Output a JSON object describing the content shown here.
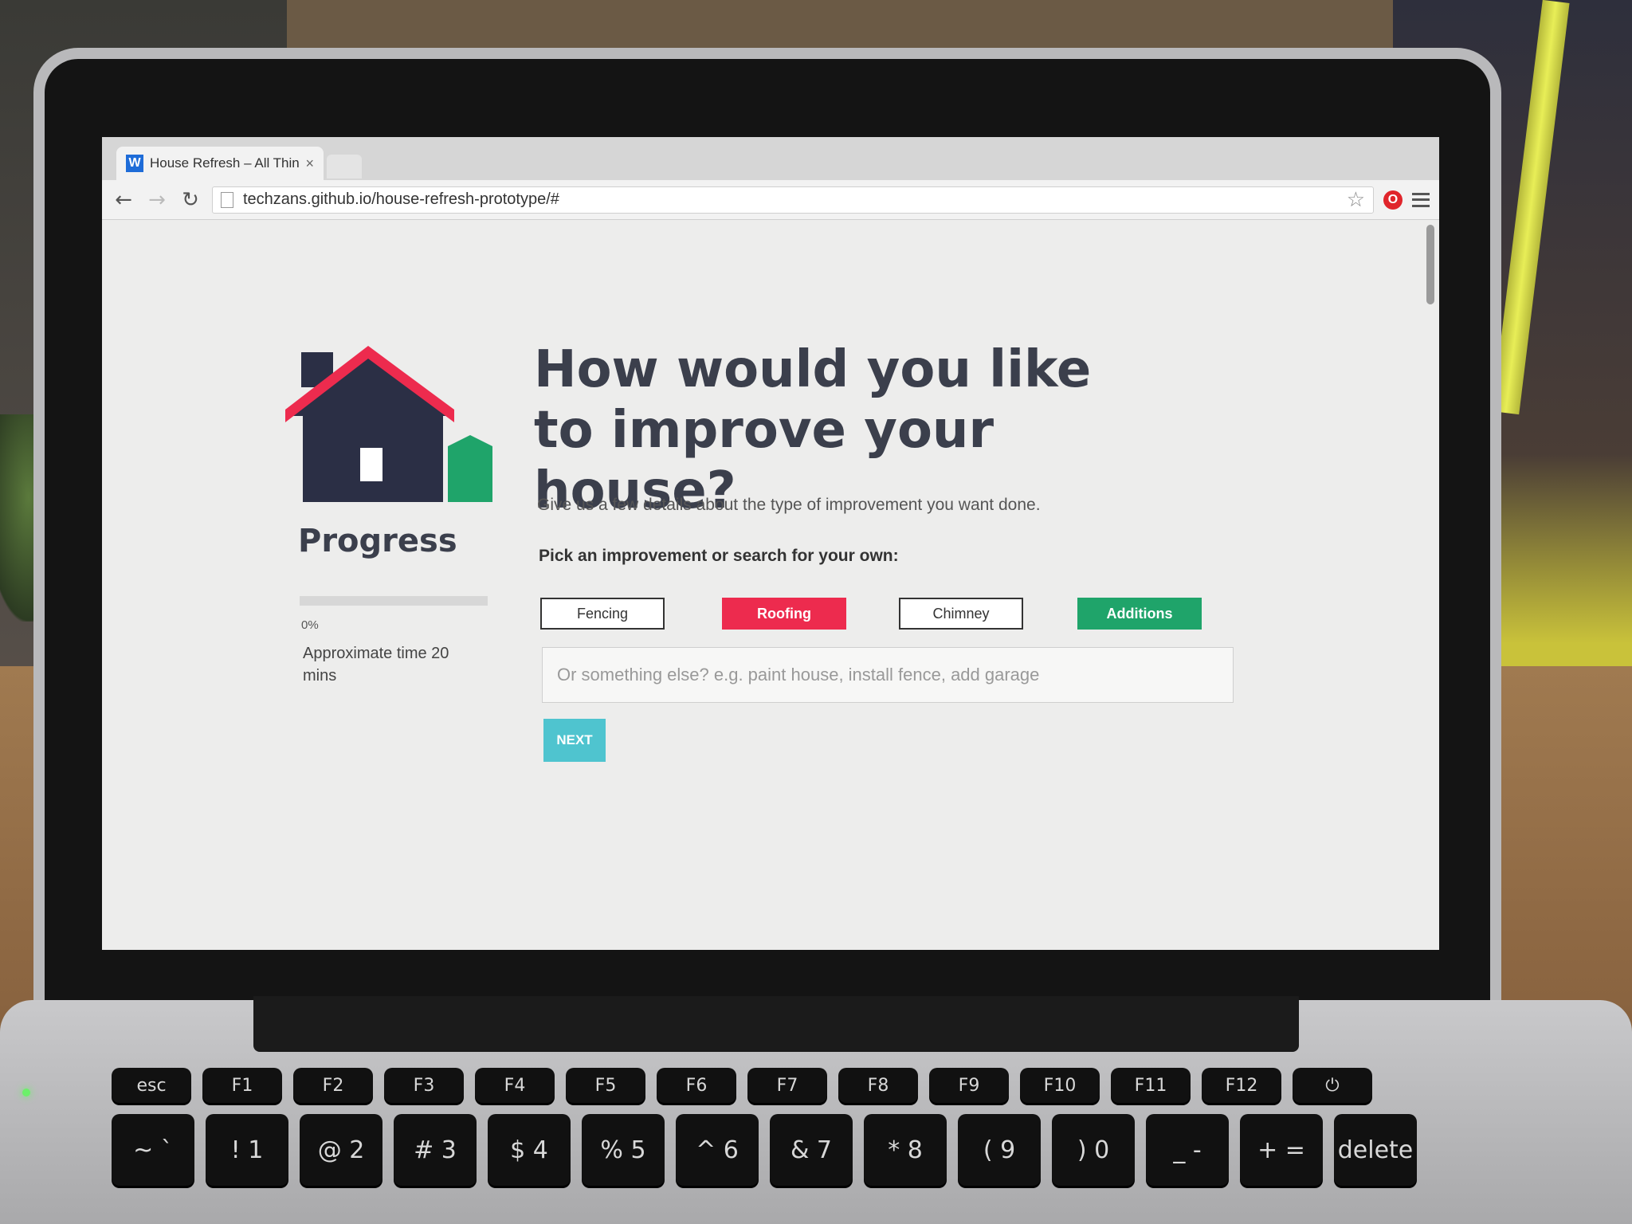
{
  "browser": {
    "tab_title": "House Refresh – All Thing",
    "favicon_letter": "W",
    "tab_close": "×",
    "url": "techzans.github.io/house-refresh-prototype/#",
    "extension_letter": "O"
  },
  "sidebar": {
    "progress_title": "Progress",
    "progress_percent": "0%",
    "progress_value": 0,
    "approx_time": "Approximate time 20 mins"
  },
  "main": {
    "headline": "How would you like to improve your house?",
    "subtext": "Give us a few details about the type of improvement you want done.",
    "pick_label": "Pick an improvement or search for your own:",
    "options": [
      {
        "label": "Fencing",
        "style": "outline"
      },
      {
        "label": "Roofing",
        "style": "red"
      },
      {
        "label": "Chimney",
        "style": "outline"
      },
      {
        "label": "Additions",
        "style": "green"
      }
    ],
    "search_placeholder": "Or something else? e.g. paint house, install fence, add garage",
    "next_label": "NEXT"
  },
  "keyboard": {
    "fn_row": [
      "esc",
      "F1",
      "F2",
      "F3",
      "F4",
      "F5",
      "F6",
      "F7",
      "F8",
      "F9",
      "F10",
      "F11",
      "F12",
      "⏻"
    ],
    "num_row": [
      "~ `",
      "! 1",
      "@ 2",
      "# 3",
      "$ 4",
      "% 5",
      "^ 6",
      "& 7",
      "* 8",
      "( 9",
      ") 0",
      "_ -",
      "+ =",
      "delete"
    ]
  },
  "colors": {
    "roof_red": "#ed2b4e",
    "house_navy": "#2b2f45",
    "accent_green": "#1fa46a",
    "next_teal": "#4fc4cf",
    "heading_text": "#3b3f4c"
  }
}
